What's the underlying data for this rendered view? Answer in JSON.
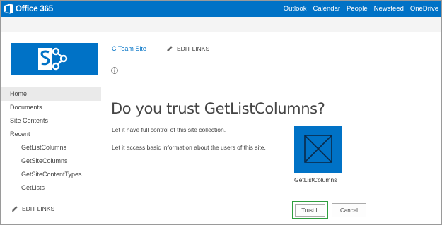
{
  "suite_bar": {
    "brand": "Office 365",
    "nav": [
      "Outlook",
      "Calendar",
      "People",
      "Newsfeed",
      "OneDrive"
    ]
  },
  "site": {
    "title": "C Team Site",
    "edit_links": "EDIT LINKS"
  },
  "left_nav": {
    "items": [
      {
        "label": "Home",
        "selected": true
      },
      {
        "label": "Documents"
      },
      {
        "label": "Site Contents"
      },
      {
        "label": "Recent"
      },
      {
        "label": "GetListColumns",
        "child": true
      },
      {
        "label": "GetSiteColumns",
        "child": true
      },
      {
        "label": "GetSiteContentTypes",
        "child": true
      },
      {
        "label": "GetLists",
        "child": true
      }
    ],
    "edit_links": "EDIT LINKS"
  },
  "dialog": {
    "heading": "Do you trust GetListColumns?",
    "permission_1": "Let it have full control of this site collection.",
    "permission_2": "Let it access basic information about the users of this site.",
    "app_name": "GetListColumns",
    "trust_button": "Trust It",
    "cancel_button": "Cancel"
  },
  "colors": {
    "suite_bar": "#0072c6",
    "accent": "#0072c6",
    "focus_outline": "#2e9e3e"
  },
  "icons": [
    "office-logo-icon",
    "sharepoint-logo-icon",
    "pencil-icon",
    "info-icon",
    "app-placeholder-icon"
  ]
}
